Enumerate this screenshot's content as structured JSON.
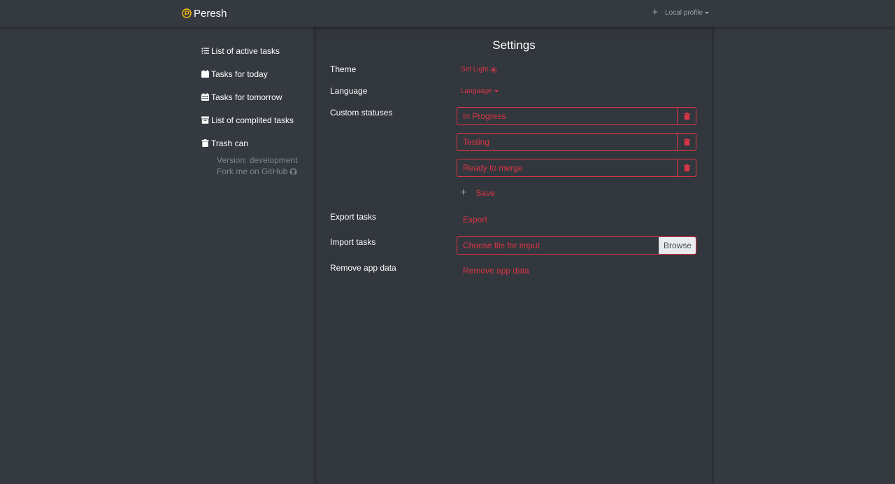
{
  "app": {
    "name": "Peresh"
  },
  "header": {
    "add_icon": "plus-icon",
    "profile_label": "Local profile"
  },
  "sidebar": {
    "items": [
      {
        "label": "List of active tasks",
        "icon": "list-check-icon"
      },
      {
        "label": "Tasks for today",
        "icon": "calendar-icon"
      },
      {
        "label": "Tasks for tomorrow",
        "icon": "calendar-grid-icon"
      },
      {
        "label": "List of complited tasks",
        "icon": "archive-icon"
      },
      {
        "label": "Trash can",
        "icon": "trash-icon"
      }
    ],
    "version": "Version: development",
    "github": "Fork me on GitHub"
  },
  "settings": {
    "title": "Settings",
    "theme": {
      "label": "Theme",
      "action": "Set Light"
    },
    "language": {
      "label": "Language",
      "action": "Language"
    },
    "custom_statuses": {
      "label": "Custom statuses",
      "items": [
        "In Progress",
        "Testing",
        "Ready to merge"
      ],
      "save_label": "Save"
    },
    "export": {
      "label": "Export tasks",
      "action": "Export"
    },
    "import": {
      "label": "Import tasks",
      "placeholder": "Choose file for imput",
      "browse": "Browse"
    },
    "remove": {
      "label": "Remove app data",
      "action": "Remove app data"
    }
  },
  "colors": {
    "accent": "#dc3545",
    "background": "#343a40",
    "brand_icon": "#ffc107"
  }
}
